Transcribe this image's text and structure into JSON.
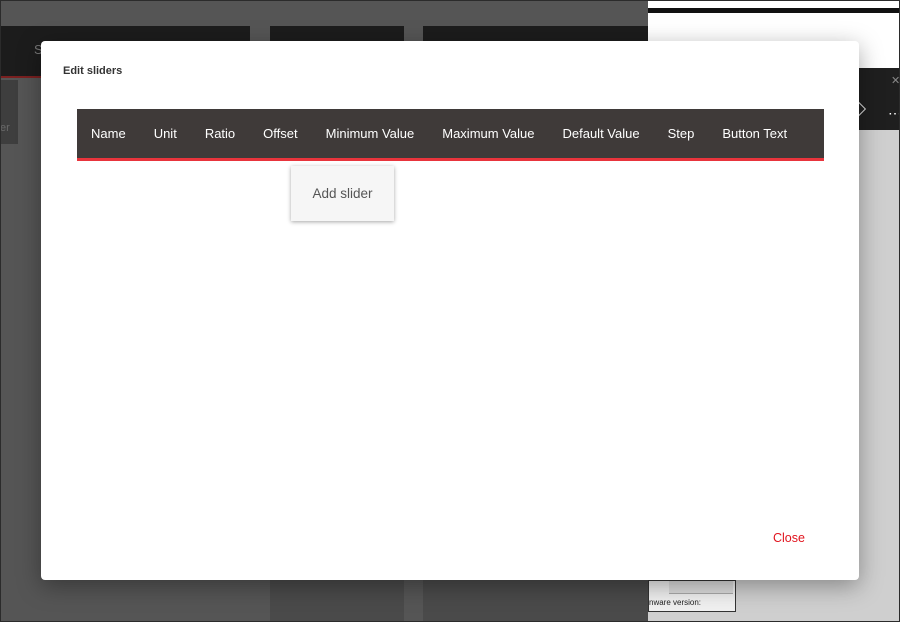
{
  "background": {
    "left_partial_text": "S",
    "left_partial_text2": "er",
    "firmware_label": "nware version:"
  },
  "dialog": {
    "title": "Edit sliders",
    "columns": [
      "Name",
      "Unit",
      "Ratio",
      "Offset",
      "Minimum Value",
      "Maximum Value",
      "Default Value",
      "Step",
      "Button Text"
    ],
    "add_button_label": "Add slider",
    "close_button_label": "Close"
  },
  "colors": {
    "header_bg": "#3f3a39",
    "header_accent": "#e8343c",
    "close_text": "#e1141e"
  }
}
